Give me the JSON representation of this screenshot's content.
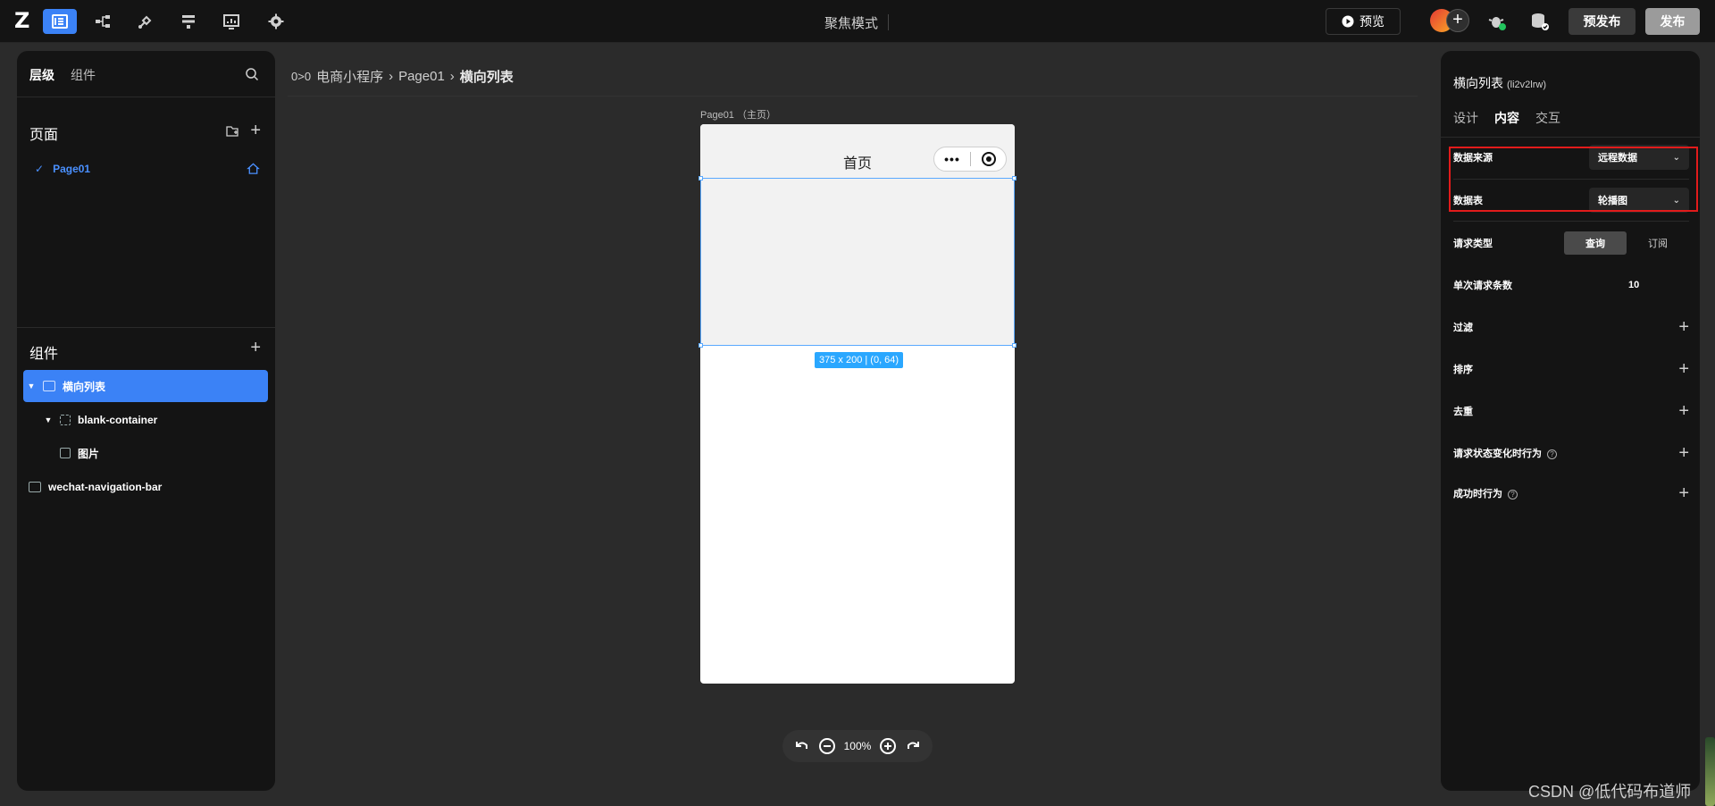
{
  "topbar": {
    "logo": "Z",
    "focus_mode": "聚焦模式",
    "preview_label": "预览",
    "prepublish_label": "预发布",
    "publish_label": "发布",
    "accent": "#3b82f6"
  },
  "left": {
    "tabs": [
      "层级",
      "组件"
    ],
    "pages_title": "页面",
    "page_item": "Page01",
    "components_title": "组件",
    "tree": [
      {
        "label": "横向列表"
      },
      {
        "label": "blank-container"
      },
      {
        "label": "图片"
      },
      {
        "label": "wechat-navigation-bar"
      }
    ]
  },
  "breadcrumb": {
    "icon": "0>0",
    "items": [
      "电商小程序",
      "Page01",
      "横向列表"
    ],
    "separator": "›"
  },
  "canvas": {
    "page_label": "Page01 （主页）",
    "phone_title": "首页",
    "capsule_dots": "•••",
    "size_tag": "375 x 200 | (0, 64)",
    "zoom": "100%"
  },
  "right": {
    "title": "横向列表",
    "id": "(li2v2lrw)",
    "tabs": [
      "设计",
      "内容",
      "交互"
    ],
    "active_tab": "内容",
    "data_source_label": "数据来源",
    "data_source_value": "远程数据",
    "table_label": "数据表",
    "table_value": "轮播图",
    "request_type_label": "请求类型",
    "request_types": [
      "查询",
      "订阅"
    ],
    "batch_label": "单次请求条数",
    "batch_value": "10",
    "filter_label": "过滤",
    "sort_label": "排序",
    "dedupe_label": "去重",
    "state_change_label": "请求状态变化时行为",
    "success_label": "成功时行为",
    "question_mark": "?",
    "highlight_color": "#e21b1b"
  },
  "watermark": "CSDN @低代码布道师"
}
